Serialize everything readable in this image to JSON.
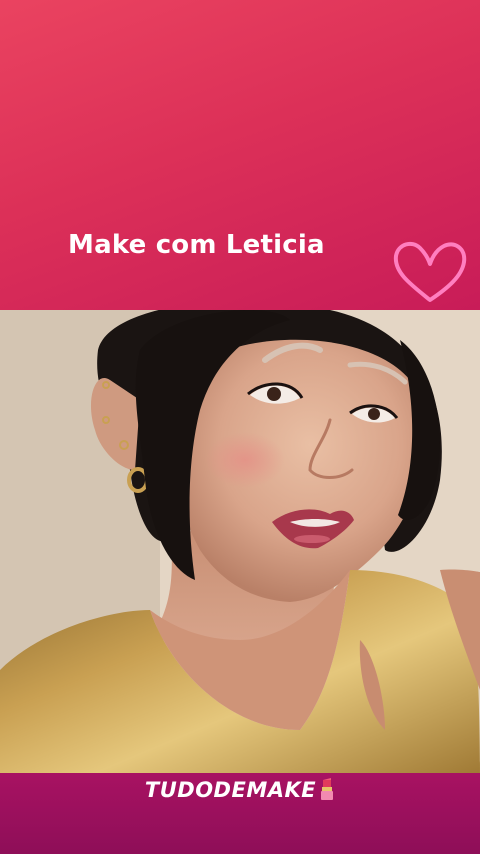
{
  "header": {
    "title": "Make com Leticia"
  },
  "footer": {
    "brand": "TUDODEMAKE"
  },
  "colors": {
    "banner_top": "#e8405f",
    "banner_bottom": "#8e0e58",
    "heart_stroke": "#ff7fc0",
    "text": "#ffffff"
  },
  "icons": {
    "heart": "heart-outline-icon",
    "lipstick": "lipstick-icon"
  }
}
